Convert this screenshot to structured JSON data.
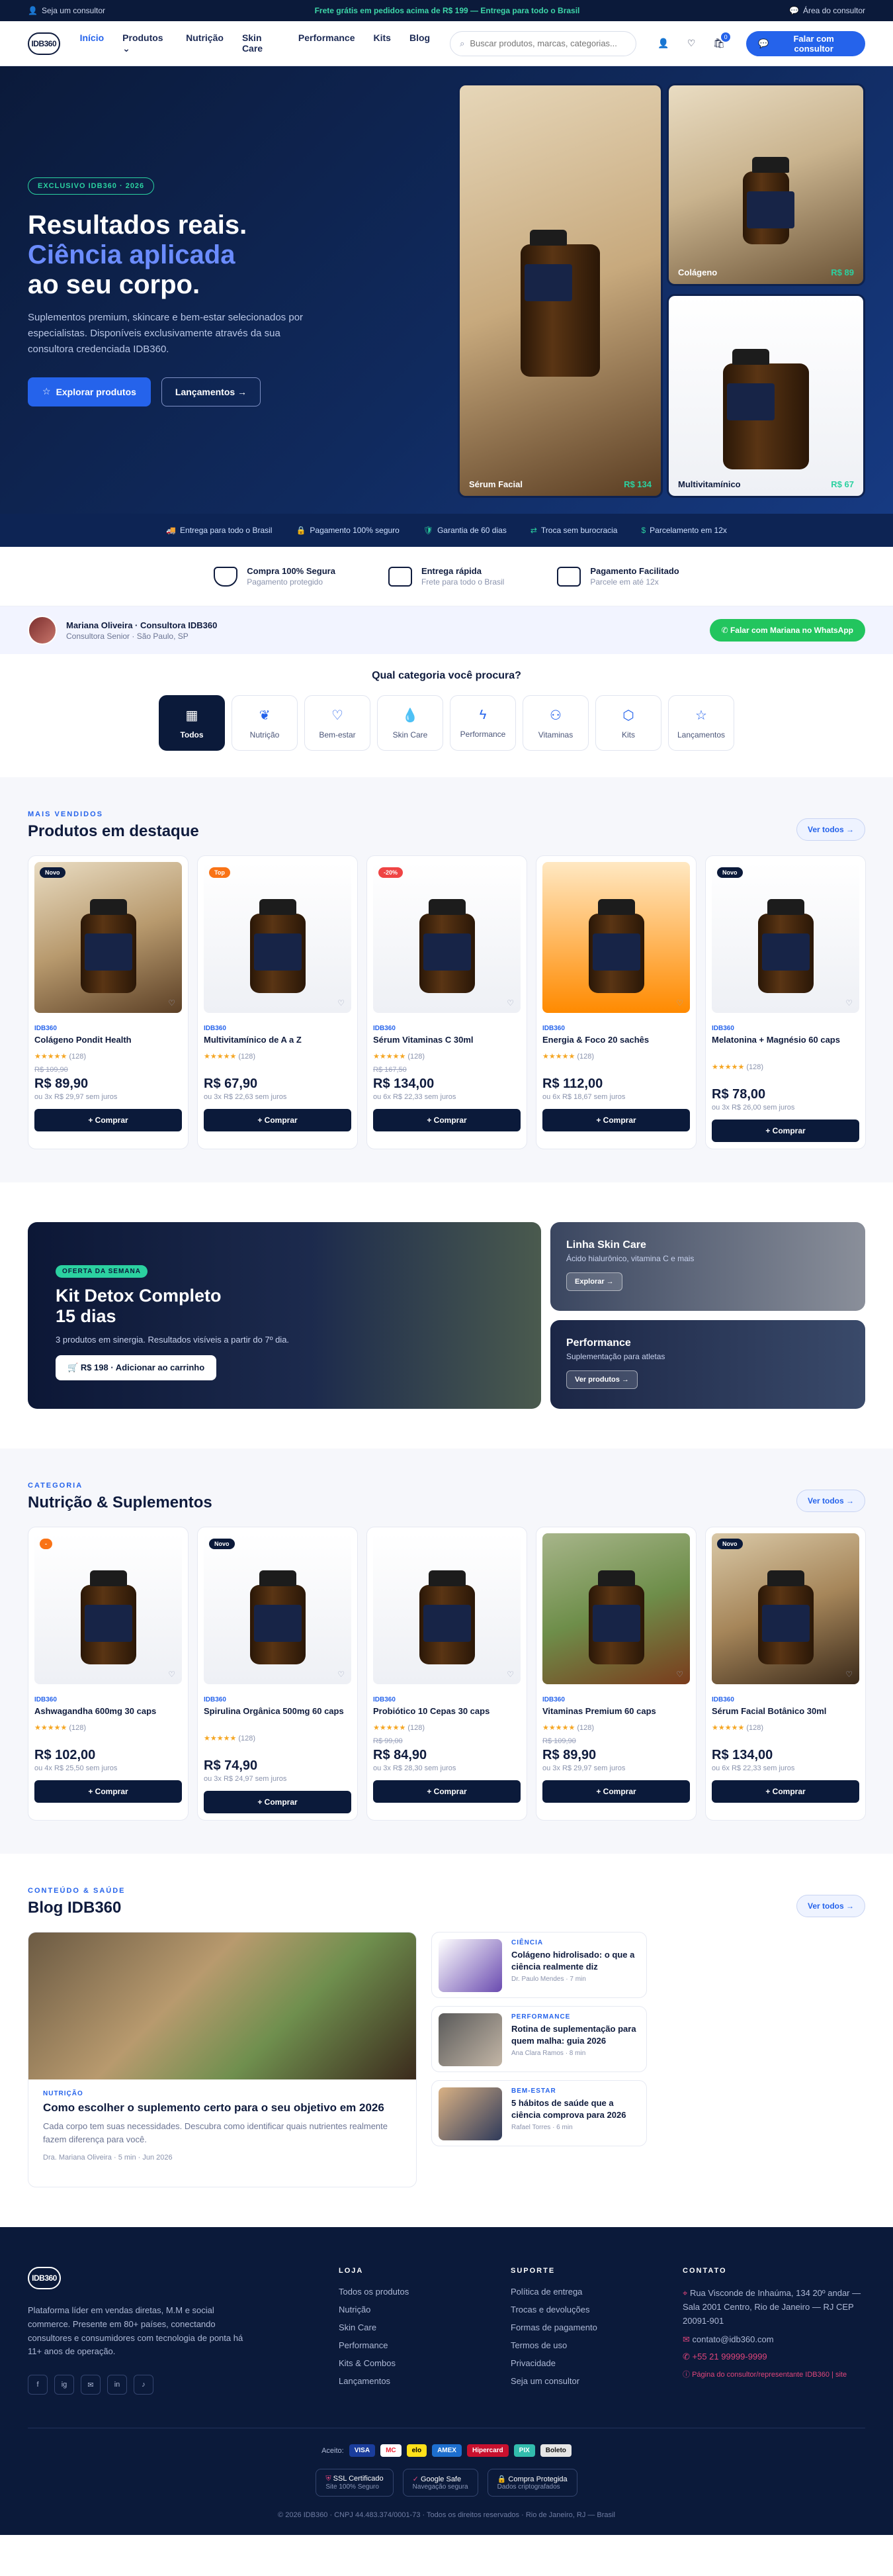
{
  "topbar": {
    "left": "Seja um consultor",
    "promo": "Frete grátis em pedidos acima de R$ 199 — Entrega para todo o Brasil",
    "right": "Área do consultor"
  },
  "header": {
    "logo": "IDB360",
    "nav": [
      "Início",
      "Produtos",
      "Nutrição",
      "Skin Care",
      "Performance",
      "Kits",
      "Blog"
    ],
    "search_placeholder": "Buscar produtos, marcas, categorias...",
    "cart_count": "0",
    "cta": "Falar com consultor"
  },
  "hero": {
    "chip": "EXCLUSIVO IDB360 · 2026",
    "title1": "Resultados reais.",
    "title2": "Ciência aplicada",
    "title3": "ao seu corpo.",
    "text": "Suplementos premium, skincare e bem-estar selecionados por especialistas. Disponíveis exclusivamente através da sua consultora credenciada IDB360.",
    "btn1": "Explorar produtos",
    "btn2": "Lançamentos →",
    "cards": [
      {
        "name": "Sérum Facial",
        "price": "R$ 134"
      },
      {
        "name": "Colágeno",
        "price": "R$ 89"
      },
      {
        "name": "Multivitamínico",
        "price": "R$ 67"
      }
    ]
  },
  "strip": [
    "Entrega para todo o Brasil",
    "Pagamento 100% seguro",
    "Garantia de 60 dias",
    "Troca sem burocracia",
    "Parcelamento em 12x"
  ],
  "trust": [
    {
      "title": "Compra 100% Segura",
      "sub": "Pagamento protegido"
    },
    {
      "title": "Entrega rápida",
      "sub": "Frete para todo o Brasil"
    },
    {
      "title": "Pagamento Facilitado",
      "sub": "Parcele em até 12x"
    }
  ],
  "consultant": {
    "name": "Mariana Oliveira · Consultora IDB360",
    "role": "Consultora Senior · São Paulo, SP",
    "cta": "Falar com Mariana no WhatsApp"
  },
  "categories": {
    "title": "Qual categoria você procura?",
    "items": [
      "Todos",
      "Nutrição",
      "Bem-estar",
      "Skin Care",
      "Performance",
      "Vitaminas",
      "Kits",
      "Lançamentos"
    ]
  },
  "featured": {
    "eyebrow": "MAIS VENDIDOS",
    "title": "Produtos em destaque",
    "btn": "Ver todos →",
    "buy": "+ Comprar",
    "products": [
      {
        "tag": "Novo",
        "brand": "IDB360",
        "name": "Colágeno Pondit Health",
        "rating": "(128)",
        "old": "R$ 109,90",
        "price": "R$ 89,90",
        "inst": "ou 3x R$ 29,97 sem juros"
      },
      {
        "tag": "Top",
        "brand": "IDB360",
        "name": "Multivitamínico de A a Z",
        "rating": "(128)",
        "old": "",
        "price": "R$ 67,90",
        "inst": "ou 3x R$ 22,63 sem juros"
      },
      {
        "tag": "-20%",
        "brand": "IDB360",
        "name": "Sérum Vitaminas C 30ml",
        "rating": "(128)",
        "old": "R$ 167,50",
        "price": "R$ 134,00",
        "inst": "ou 6x R$ 22,33 sem juros"
      },
      {
        "tag": "",
        "brand": "IDB360",
        "name": "Energia & Foco 20 sachês",
        "rating": "(128)",
        "old": "",
        "price": "R$ 112,00",
        "inst": "ou 6x R$ 18,67 sem juros"
      },
      {
        "tag": "Novo",
        "brand": "IDB360",
        "name": "Melatonina + Magnésio 60 caps",
        "rating": "(128)",
        "old": "",
        "price": "R$ 78,00",
        "inst": "ou 3x R$ 26,00 sem juros"
      }
    ]
  },
  "promo": {
    "chip": "OFERTA DA SEMANA",
    "title": "Kit Detox Completo 15 dias",
    "text": "3 produtos em sinergia. Resultados visíveis a partir do 7º dia.",
    "btn": "R$ 198 · Adicionar ao carrinho",
    "side": [
      {
        "title": "Linha Skin Care",
        "text": "Ácido hialurônico, vitamina C e mais",
        "btn": "Explorar →"
      },
      {
        "title": "Performance",
        "text": "Suplementação para atletas",
        "btn": "Ver produtos →"
      }
    ]
  },
  "nutrition": {
    "eyebrow": "CATEGORIA",
    "title": "Nutrição & Suplementos",
    "btn": "Ver todos →",
    "buy": "+ Comprar",
    "products": [
      {
        "tag": "-",
        "brand": "IDB360",
        "name": "Ashwagandha 600mg 30 caps",
        "rating": "(128)",
        "old": "",
        "price": "R$ 102,00",
        "inst": "ou 4x R$ 25,50 sem juros"
      },
      {
        "tag": "Novo",
        "brand": "IDB360",
        "name": "Spirulina Orgânica 500mg 60 caps",
        "rating": "(128)",
        "old": "",
        "price": "R$ 74,90",
        "inst": "ou 3x R$ 24,97 sem juros"
      },
      {
        "tag": "",
        "brand": "IDB360",
        "name": "Probiótico 10 Cepas 30 caps",
        "rating": "(128)",
        "old": "R$ 99,00",
        "price": "R$ 84,90",
        "inst": "ou 3x R$ 28,30 sem juros"
      },
      {
        "tag": "",
        "brand": "IDB360",
        "name": "Vitaminas Premium 60 caps",
        "rating": "(128)",
        "old": "R$ 109,90",
        "price": "R$ 89,90",
        "inst": "ou 3x R$ 29,97 sem juros"
      },
      {
        "tag": "Novo",
        "brand": "IDB360",
        "name": "Sérum Facial Botânico 30ml",
        "rating": "(128)",
        "old": "",
        "price": "R$ 134,00",
        "inst": "ou 6x R$ 22,33 sem juros"
      }
    ]
  },
  "blog": {
    "eyebrow": "CONTEÚDO & SAÚDE",
    "title": "Blog IDB360",
    "btn": "Ver todos →",
    "main": {
      "cat": "NUTRIÇÃO",
      "title": "Como escolher o suplemento certo para o seu objetivo em 2026",
      "text": "Cada corpo tem suas necessidades. Descubra como identificar quais nutrientes realmente fazem diferença para você.",
      "meta": "Dra. Mariana Oliveira · 5 min · Jun 2026"
    },
    "side": [
      {
        "cat": "CIÊNCIA",
        "title": "Colágeno hidrolisado: o que a ciência realmente diz",
        "meta": "Dr. Paulo Mendes · 7 min"
      },
      {
        "cat": "PERFORMANCE",
        "title": "Rotina de suplementação para quem malha: guia 2026",
        "meta": "Ana Clara Ramos · 8 min"
      },
      {
        "cat": "BEM-ESTAR",
        "title": "5 hábitos de saúde que a ciência comprova para 2026",
        "meta": "Rafael Torres · 6 min"
      }
    ]
  },
  "footer": {
    "about": "Plataforma líder em vendas diretas, M.M e social commerce. Presente em 80+ países, conectando consultores e consumidores com tecnologia de ponta há 11+ anos de operação.",
    "socials": [
      "f",
      "ig",
      "✉",
      "in",
      "♪"
    ],
    "loja_title": "LOJA",
    "loja": [
      "Todos os produtos",
      "Nutrição",
      "Skin Care",
      "Performance",
      "Kits & Combos",
      "Lançamentos"
    ],
    "suporte_title": "SUPORTE",
    "suporte": [
      "Política de entrega",
      "Trocas e devoluções",
      "Formas de pagamento",
      "Termos de uso",
      "Privacidade",
      "Seja um consultor"
    ],
    "contato_title": "CONTATO",
    "address": "Rua Visconde de Inhaúma, 134 20º andar — Sala 2001 Centro, Rio de Janeiro — RJ CEP 20091-901",
    "email": "contato@idb360.com",
    "phone": "+55 21 99999-9999",
    "consult_link": "Página do consultor/representante IDB360 | site",
    "pay_label": "Aceito:",
    "pay": [
      "VISA",
      "MC",
      "elo",
      "AMEX",
      "Hipercard",
      "PIX",
      "Boleto"
    ],
    "seals": [
      {
        "t": "SSL Certificado",
        "s": "Site 100% Seguro"
      },
      {
        "t": "Google Safe",
        "s": "Navegação segura"
      },
      {
        "t": "Compra Protegida",
        "s": "Dados criptografados"
      }
    ],
    "copy": "© 2026 IDB360 · CNPJ 44.483.374/0001-73 · Todos os direitos reservados · Rio de Janeiro, RJ — Brasil"
  }
}
